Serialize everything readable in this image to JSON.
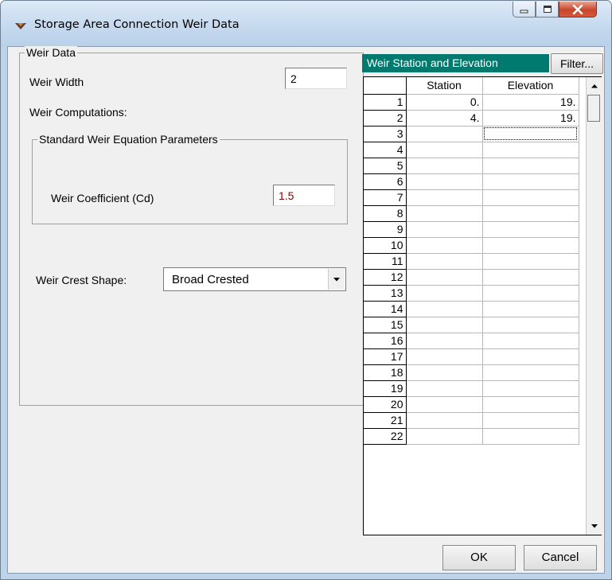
{
  "window": {
    "title": "Storage Area Connection Weir Data"
  },
  "weir_data": {
    "legend": "Weir Data",
    "width_label": "Weir Width",
    "width_value": "2",
    "computations_label": "Weir Computations:",
    "standard_group_legend": "Standard Weir Equation Parameters",
    "coefficient_label": "Weir Coefficient (Cd)",
    "coefficient_value": "1.5",
    "crest_shape_label": "Weir Crest Shape:",
    "crest_shape_value": "Broad Crested"
  },
  "table": {
    "header": "Weir Station and Elevation",
    "filter_label": "Filter...",
    "columns": [
      "Station",
      "Elevation"
    ],
    "rows": [
      {
        "n": "1",
        "station": "0.",
        "elevation": "19."
      },
      {
        "n": "2",
        "station": "4.",
        "elevation": "19."
      },
      {
        "n": "3",
        "station": "",
        "elevation": ""
      },
      {
        "n": "4",
        "station": "",
        "elevation": ""
      },
      {
        "n": "5",
        "station": "",
        "elevation": ""
      },
      {
        "n": "6",
        "station": "",
        "elevation": ""
      },
      {
        "n": "7",
        "station": "",
        "elevation": ""
      },
      {
        "n": "8",
        "station": "",
        "elevation": ""
      },
      {
        "n": "9",
        "station": "",
        "elevation": ""
      },
      {
        "n": "10",
        "station": "",
        "elevation": ""
      },
      {
        "n": "11",
        "station": "",
        "elevation": ""
      },
      {
        "n": "12",
        "station": "",
        "elevation": ""
      },
      {
        "n": "13",
        "station": "",
        "elevation": ""
      },
      {
        "n": "14",
        "station": "",
        "elevation": ""
      },
      {
        "n": "15",
        "station": "",
        "elevation": ""
      },
      {
        "n": "16",
        "station": "",
        "elevation": ""
      },
      {
        "n": "17",
        "station": "",
        "elevation": ""
      },
      {
        "n": "18",
        "station": "",
        "elevation": ""
      },
      {
        "n": "19",
        "station": "",
        "elevation": ""
      },
      {
        "n": "20",
        "station": "",
        "elevation": ""
      },
      {
        "n": "21",
        "station": "",
        "elevation": ""
      },
      {
        "n": "22",
        "station": "",
        "elevation": ""
      }
    ],
    "focused_row": 2
  },
  "buttons": {
    "ok": "OK",
    "cancel": "Cancel"
  },
  "colors": {
    "table_header_bg": "#007a6e",
    "coefficient_text": "#8b0000",
    "close_button": "#c8452b"
  },
  "icons": [
    "weir-icon",
    "minimize-icon",
    "maximize-icon",
    "close-icon",
    "dropdown-arrow-icon",
    "scroll-up-icon",
    "scroll-down-icon"
  ]
}
